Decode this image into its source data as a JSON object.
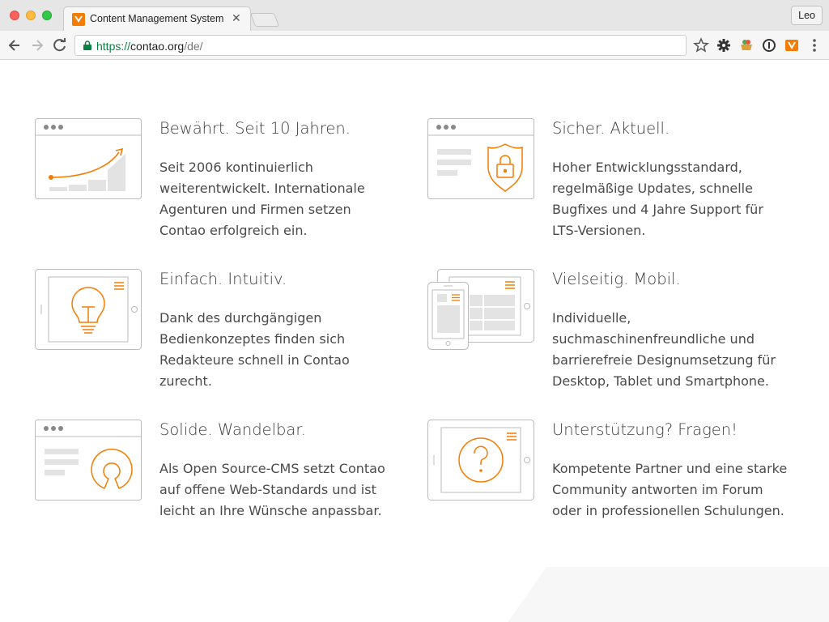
{
  "browser": {
    "tab_title": "Content Management System",
    "profile": "Leo",
    "url": {
      "scheme": "https://",
      "host": "contao.org",
      "path": "/de/"
    }
  },
  "features": [
    {
      "title": "Bewährt. Seit 10 Jahren.",
      "lines": [
        "Seit 2006 kontinuierlich",
        "weiterentwickelt. Internationale",
        "Agenturen und Firmen setzen",
        "Contao erfolgreich ein."
      ],
      "icon": "growth-chart-icon"
    },
    {
      "title": "Sicher. Aktuell.",
      "lines": [
        "Hoher Entwicklungsstandard,",
        "regelmäßige Updates, schnelle",
        "Bugfixes und 4 Jahre Support für",
        "LTS-Versionen."
      ],
      "icon": "shield-lock-icon"
    },
    {
      "title": "Einfach. Intuitiv.",
      "lines": [
        "Dank des durchgängigen",
        "Bedienkonzeptes finden sich",
        "Redakteure schnell in Contao",
        "zurecht."
      ],
      "icon": "lightbulb-tablet-icon"
    },
    {
      "title": "Vielseitig. Mobil.",
      "lines": [
        "Individuelle,",
        "suchmaschinenfreundliche und",
        "barrierefreie Designumsetzung für",
        "Desktop, Tablet und Smartphone."
      ],
      "icon": "devices-icon"
    },
    {
      "title": "Solide. Wandelbar.",
      "lines": [
        "Als Open Source-CMS setzt Contao",
        "auf offene Web-Standards und ist",
        "leicht an Ihre Wünsche anpassbar."
      ],
      "icon": "open-source-icon"
    },
    {
      "title": "Unterstützung? Fragen!",
      "lines": [
        "Kompetente Partner und eine starke",
        "Community antworten im Forum",
        "oder in professionellen Schulungen."
      ],
      "icon": "question-tablet-icon"
    }
  ],
  "colors": {
    "accent": "#f47c00",
    "icon_line": "#bbbbbb",
    "icon_fill": "#e3e3e3"
  }
}
